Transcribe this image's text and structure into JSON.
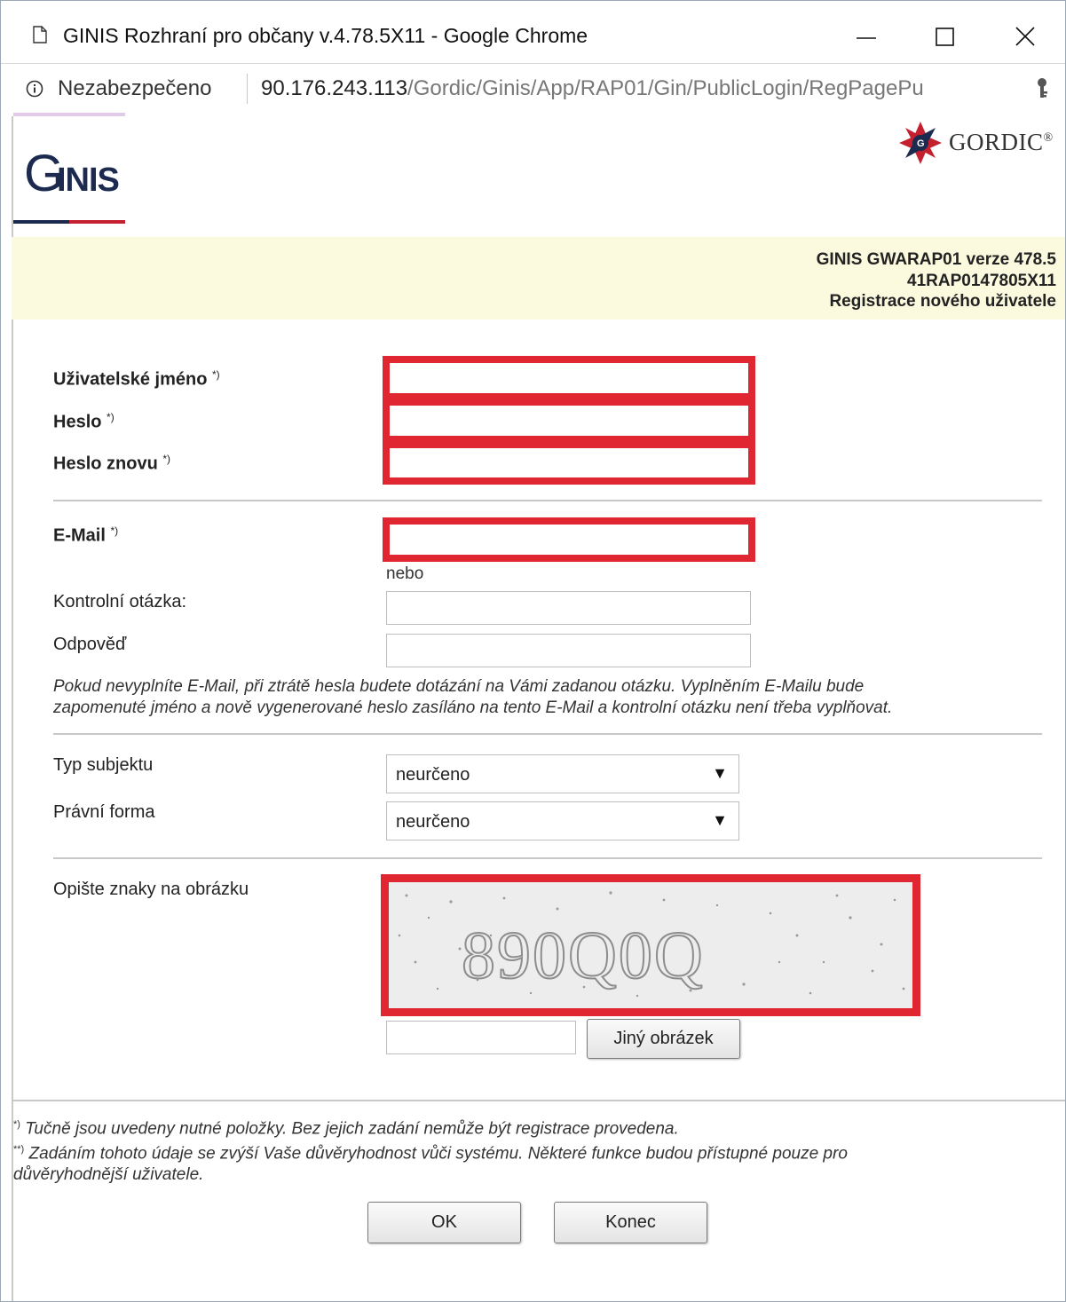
{
  "browser": {
    "title": "GINIS Rozhraní pro občany v.4.78.5X11 - Google Chrome",
    "security_label": "Nezabezpečeno",
    "url_host": "90.176.243.113",
    "url_path": "/Gordic/Ginis/App/RAP01/Gin/PublicLogin/RegPagePu"
  },
  "header": {
    "brand_logo_text": "GINIS",
    "gordic_text": "GORDIC",
    "gordic_mark": "®",
    "version_line": "GINIS GWARAP01 verze 478.5",
    "build_line": "41RAP0147805X11",
    "page_title": "Registrace nového uživatele"
  },
  "form": {
    "username_label": "Uživatelské jméno",
    "password_label": "Heslo",
    "password_again_label": "Heslo znovu",
    "email_label": "E-Mail",
    "required_mark": "*)",
    "or_text": "nebo",
    "control_question_label": "Kontrolní otázka:",
    "answer_label": "Odpověď",
    "email_note_line1": "Pokud nevyplníte E-Mail, při ztrátě hesla budete dotázání na Vámi zadanou otázku. Vyplněním E-Mailu bude",
    "email_note_line2": "zapomenuté jméno a nově vygenerované heslo zasíláno na tento E-Mail a kontrolní otázku není třeba vyplňovat.",
    "subject_type_label": "Typ subjektu",
    "subject_type_value": "neurčeno",
    "legal_form_label": "Právní forma",
    "legal_form_value": "neurčeno",
    "captcha_label": "Opište znaky na obrázku",
    "captcha_text": "890Q0Q",
    "other_image_button": "Jiný obrázek"
  },
  "footer": {
    "note1_mark": "*)",
    "note1": "Tučně jsou uvedeny nutné položky. Bez jejich zadání nemůže být registrace provedena.",
    "note2_mark": "**)",
    "note2_line1": "Zadáním tohoto údaje se zvýší Vaše důvěryhodnost vůči systému. Některé funkce budou přístupné pouze pro",
    "note2_line2": "důvěryhodnější uživatele.",
    "ok_button": "OK",
    "end_button": "Konec"
  },
  "colors": {
    "highlight_red": "#e02631",
    "info_band": "#fbf9de",
    "ginis_navy": "#1d2a4f",
    "ginis_red": "#c4202f"
  },
  "icons": {
    "page_icon": "document-icon",
    "info_icon": "info-icon",
    "key_icon": "key-icon"
  }
}
